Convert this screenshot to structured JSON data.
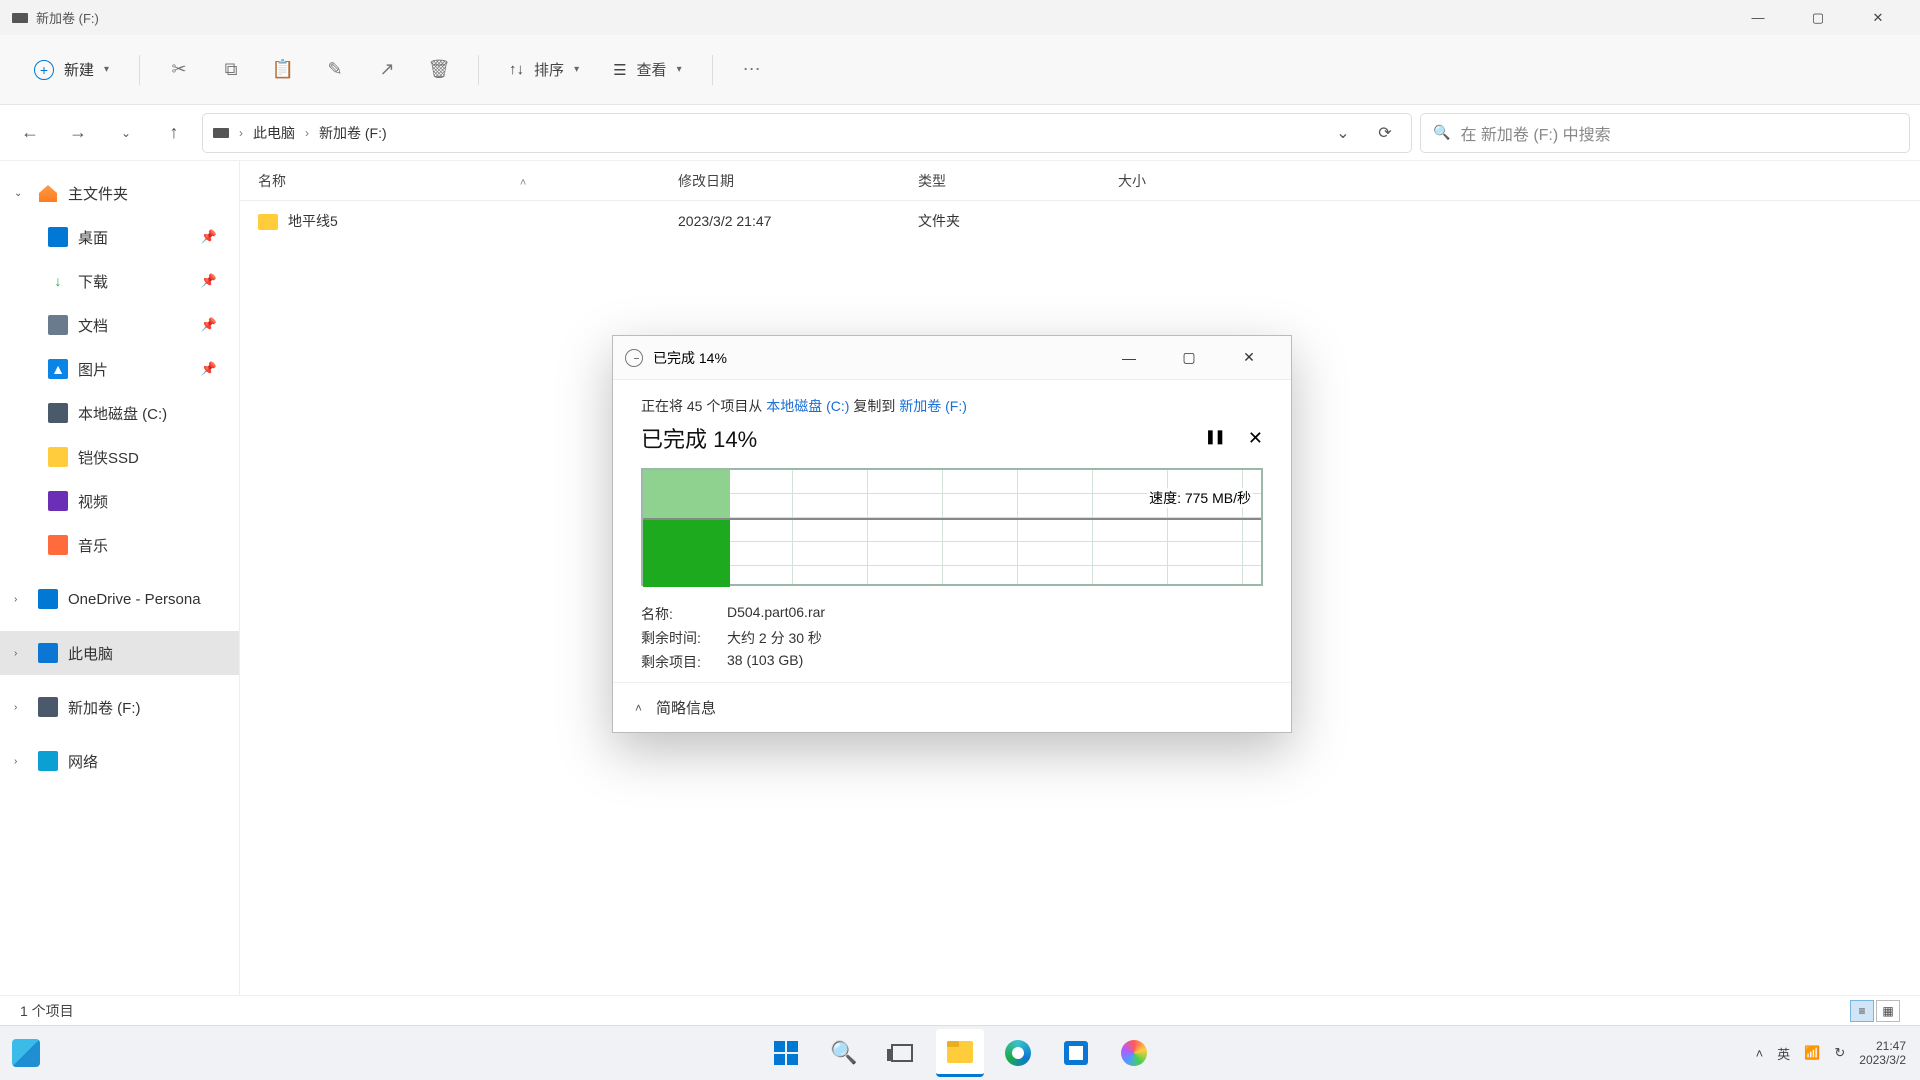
{
  "window": {
    "title": "新加卷 (F:)",
    "minimize": "—",
    "maximize": "▢",
    "close": "✕"
  },
  "toolbar": {
    "new": "新建",
    "sort": "排序",
    "view": "查看"
  },
  "breadcrumb": {
    "pc": "此电脑",
    "drive": "新加卷 (F:)"
  },
  "search": {
    "placeholder": "在 新加卷 (F:) 中搜索"
  },
  "columns": {
    "name": "名称",
    "date": "修改日期",
    "type": "类型",
    "size": "大小"
  },
  "sidebar": {
    "home": "主文件夹",
    "desktop": "桌面",
    "downloads": "下载",
    "documents": "文档",
    "pictures": "图片",
    "localdisk": "本地磁盘 (C:)",
    "kioxia": "铠侠SSD",
    "videos": "视频",
    "music": "音乐",
    "onedrive": "OneDrive - Persona",
    "thispc": "此电脑",
    "newvol": "新加卷 (F:)",
    "network": "网络"
  },
  "files": [
    {
      "name": "地平线5",
      "date": "2023/3/2 21:47",
      "type": "文件夹",
      "size": ""
    }
  ],
  "status": {
    "count": "1 个项目"
  },
  "dialog": {
    "title": "已完成 14%",
    "line_prefix": "正在将 45 个项目从 ",
    "src": "本地磁盘 (C:)",
    "line_mid": " 复制到 ",
    "dst": "新加卷 (F:)",
    "progress_label": "已完成 14%",
    "pause": "❚❚",
    "cancel": "✕",
    "speed_label": "速度: 775 MB/秒",
    "progress_percent": 14,
    "name_label": "名称:",
    "name_value": "D504.part06.rar",
    "time_label": "剩余时间:",
    "time_value": "大约 2 分 30 秒",
    "items_label": "剩余项目:",
    "items_value": "38 (103 GB)",
    "collapse": "简略信息"
  },
  "taskbar": {
    "ime": "英",
    "time": "21:47",
    "date": "2023/3/2"
  }
}
